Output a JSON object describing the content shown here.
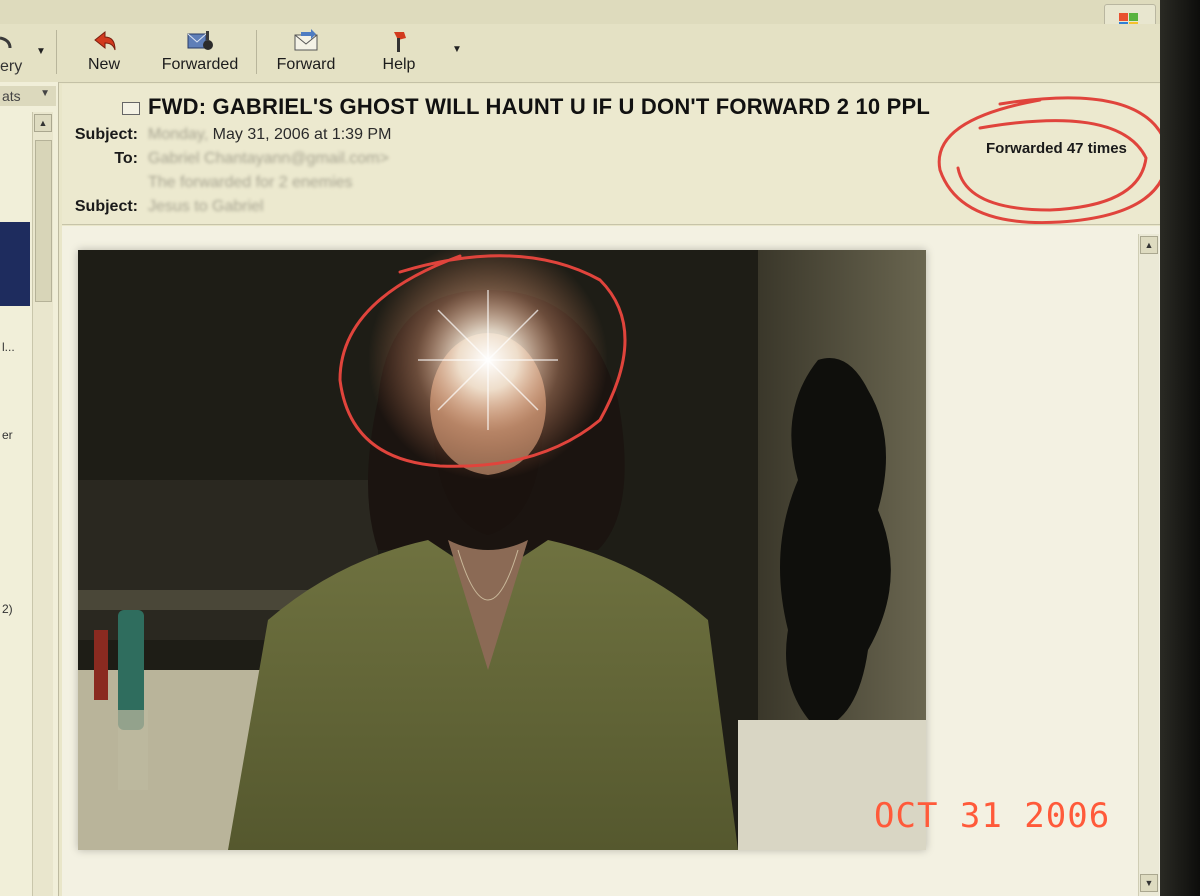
{
  "toolbar": {
    "partial_left_label": "ery",
    "buttons": [
      {
        "label": "New",
        "icon": "reply-arrow-icon"
      },
      {
        "label": "Forwarded",
        "icon": "forwarded-mail-icon"
      },
      {
        "label": "Forward",
        "icon": "forward-envelope-icon"
      },
      {
        "label": "Help",
        "icon": "help-icon"
      }
    ]
  },
  "left_pane": {
    "header": "ats",
    "snippets": [
      "l...",
      "er",
      "2)"
    ]
  },
  "message": {
    "title": "FWD: GABRIEL'S GHOST WILL HAUNT U IF U DON'T FORWARD 2 10 PPL",
    "labels": {
      "subject": "Subject:",
      "to": "To:",
      "subject2": "Subject:"
    },
    "date_prefix_blurred": "Monday,",
    "date": "May 31, 2006 at 1:39 PM",
    "to_blurred": "Gabriel Chantayann@gmail.com>",
    "line3_blurred": "The forwarded for 2 enemies",
    "subject2_blurred": "Jesus to Gabriel",
    "forwarded_count": "Forwarded 47 times"
  },
  "photo_stamp": "OCT 31 2006",
  "colors": {
    "annotation_red": "#e0443c",
    "stamp": "#ff5a3a",
    "shirt": "#6b6e3a"
  }
}
